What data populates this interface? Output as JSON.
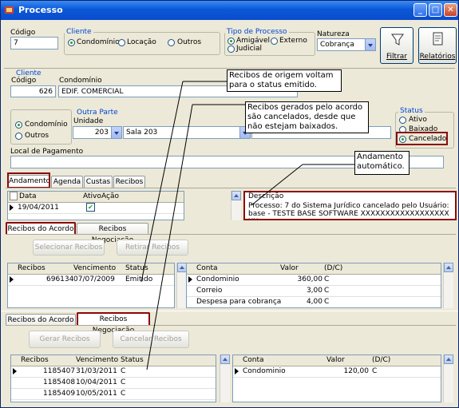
{
  "window": {
    "title": "Processo"
  },
  "codigo": {
    "label": "Código",
    "value": "7"
  },
  "cliente_tipo": {
    "label": "Cliente",
    "options": [
      "Condomínio",
      "Locação",
      "Outros"
    ],
    "selected": "Condomínio"
  },
  "tipo_processo": {
    "label": "Tipo de Processo",
    "options": [
      "Amigável",
      "Externo",
      "Judicial"
    ],
    "selected": "Amigável"
  },
  "natureza": {
    "label": "Natureza",
    "value": "Cobrança"
  },
  "toolbar": {
    "filtrar": "Filtrar",
    "relatorios": "Relatórios"
  },
  "cliente": {
    "legend": "Cliente",
    "codigo_label": "Código",
    "codigo_value": "626",
    "condominio_label": "Condomínio",
    "condominio_value": "EDIF. COMERCIAL"
  },
  "outra_parte": {
    "legend": "Outra Parte",
    "options": [
      "Condomínio",
      "Outros"
    ],
    "selected": "Condomínio",
    "unidade_label": "Unidade",
    "unidade_value": "203",
    "sala_value": "Sala 203"
  },
  "status": {
    "legend": "Status",
    "options": [
      "Ativo",
      "Baixado",
      "Cancelado"
    ],
    "selected": "Cancelado"
  },
  "local_pagamento": {
    "label": "Local de Pagamento",
    "value": ""
  },
  "main_tabs": [
    "Andamento",
    "Agenda",
    "Custas",
    "Recibos"
  ],
  "andamento": {
    "columns": [
      "Data",
      "Ativo",
      "Ação"
    ],
    "rows": [
      {
        "data": "19/04/2011",
        "ativo": true
      }
    ],
    "descricao_label": "Descrição",
    "descricao_text": "Processo: 7 do Sistema Jurídico cancelado pelo Usuário:base - TESTE BASE SOFTWARE XXXXXXXXXXXXXXXXXXXX"
  },
  "recibos_tabs_1": [
    "Recibos do Acordo",
    "Recibos Negociação"
  ],
  "recibos_acordo": {
    "buttons": [
      "Selecionar Recibos",
      "Retirar Recibos"
    ],
    "columns": [
      "Recibos",
      "Vencimento",
      "Status"
    ],
    "rows": [
      {
        "recibo": "696134",
        "vencimento": "07/07/2009",
        "status": "Emitido"
      }
    ],
    "conta_columns": [
      "Conta",
      "Valor",
      "(D/C)"
    ],
    "conta_rows": [
      {
        "conta": "Condominio",
        "valor": "360,00",
        "dc": "C"
      },
      {
        "conta": "Correio",
        "valor": "3,00",
        "dc": "C"
      },
      {
        "conta": "Despesa para cobrança",
        "valor": "4,00",
        "dc": "C"
      }
    ]
  },
  "recibos_tabs_2": [
    "Recibos do Acordo",
    "Recibos Negociação"
  ],
  "recibos_negociacao": {
    "buttons": [
      "Gerar Recibos",
      "Cancelar Recibos"
    ],
    "columns": [
      "Recibos",
      "Vencimento",
      "Status"
    ],
    "rows": [
      {
        "recibo": "1185407",
        "vencimento": "31/03/2011",
        "status": "C"
      },
      {
        "recibo": "1185408",
        "vencimento": "10/04/2011",
        "status": "C"
      },
      {
        "recibo": "1185409",
        "vencimento": "10/05/2011",
        "status": "C"
      }
    ],
    "conta_columns": [
      "Conta",
      "Valor",
      "(D/C)"
    ],
    "conta_rows": [
      {
        "conta": "Condominio",
        "valor": "120,00",
        "dc": "C"
      }
    ]
  },
  "callouts": {
    "c1": "Recibos de origem voltam para o status emitido.",
    "c2": "Recibos gerados pelo acordo são cancelados, desde que não estejam baixados.",
    "c3": "Andamento automático."
  },
  "colors": {
    "title_bar": "#0a58d8",
    "highlight_box": "#8b0a0a",
    "legend_text": "#0046d5",
    "window_bg": "#ece9d8"
  },
  "icons": [
    "app-icon",
    "minimize-icon",
    "maximize-icon",
    "close-icon",
    "filter-icon",
    "report-icon",
    "row-pointer-icon",
    "checkbox-icon"
  ]
}
